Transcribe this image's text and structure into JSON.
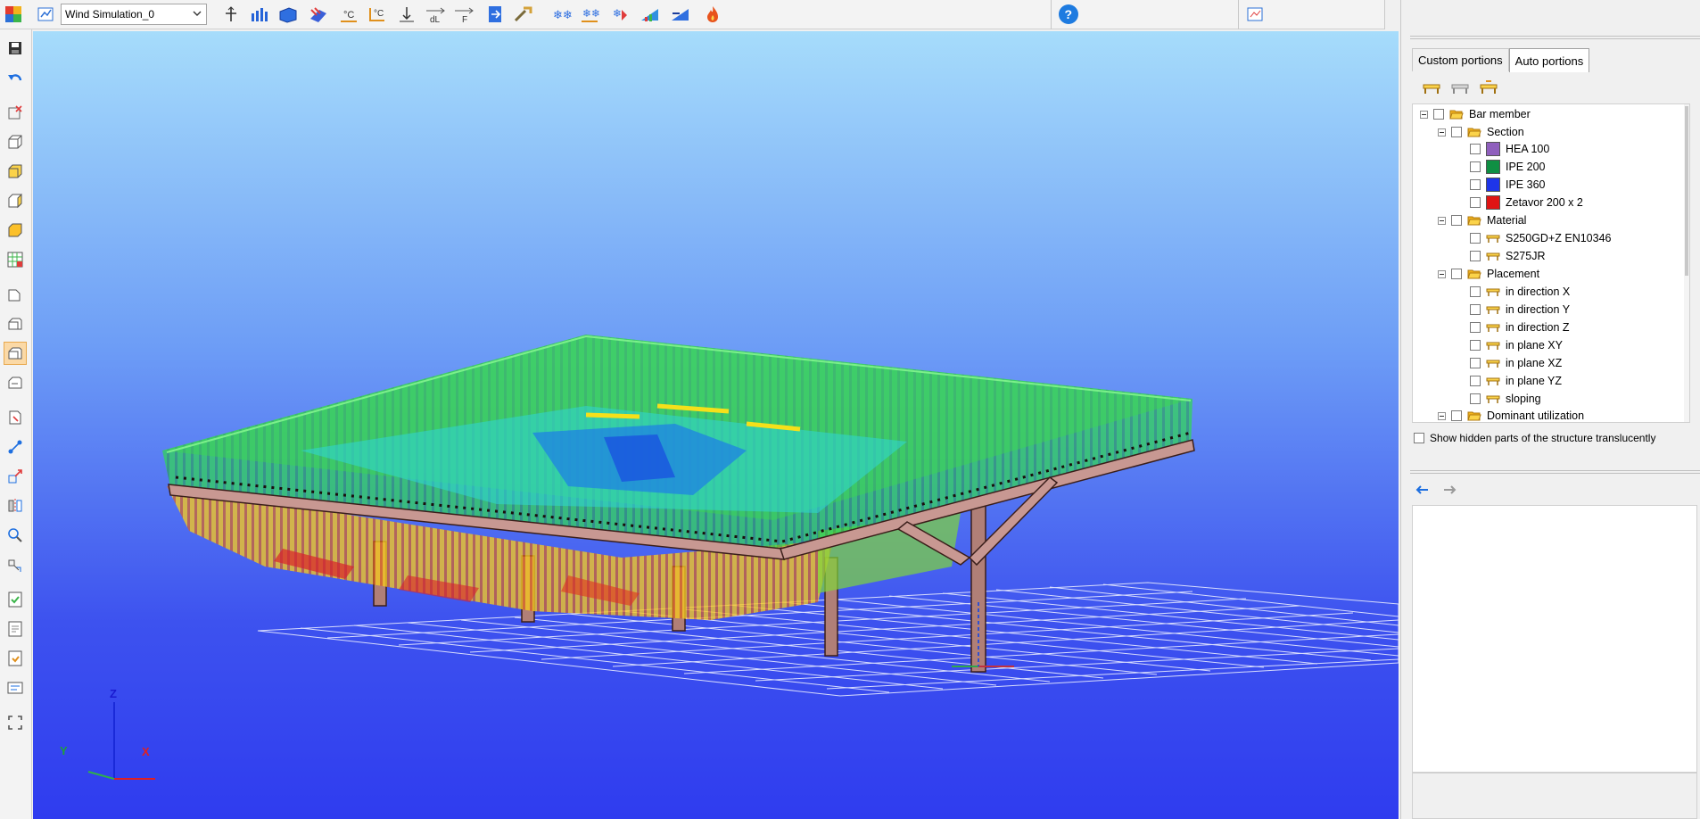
{
  "toolbar": {
    "app_icon": "app-logo-icon",
    "simulation_select": {
      "value": "Wind Simulation_0"
    },
    "tools": [
      "probe-icon",
      "velocity-bars-icon",
      "pressure-surface-icon",
      "streamlines-icon",
      "temperature-c-icon",
      "temperature-gradient-icon",
      "height-icon",
      "delta-length-icon",
      "force-icon",
      "export-icon",
      "wind-tunnel-icon",
      "snow-flakes-icon",
      "snow-drift-icon",
      "snow-load-icon",
      "wind-profile-icon",
      "wind-surface-icon",
      "fire-icon"
    ],
    "help_icon": "help-icon",
    "layout_icon": "layout-icon"
  },
  "left_tools": [
    "save-icon",
    "undo-icon",
    "select-nodes-icon",
    "view-front-icon",
    "view-top-icon",
    "view-side-icon",
    "view-iso-icon",
    "grid-view-icon",
    "model-2d-icon",
    "model-3d-icon",
    "render-mode-icon",
    "render-wire-icon",
    "member-select-icon",
    "node-select-icon",
    "move-icon",
    "mirror-icon",
    "search-icon",
    "transform-icon",
    "check-icon",
    "doc-icon",
    "load-icon",
    "list-icon",
    "fit-view-icon"
  ],
  "axes": {
    "z": "Z",
    "y": "Y",
    "x": "X"
  },
  "panel": {
    "tabs": [
      "Custom portions",
      "Auto portions"
    ],
    "active_tab": 1,
    "tree": {
      "root": "Bar member",
      "section": "Section",
      "section_items": [
        {
          "label": "HEA 100",
          "color": "#8f5fbd"
        },
        {
          "label": "IPE 200",
          "color": "#0f8f43"
        },
        {
          "label": "IPE 360",
          "color": "#1e35e8"
        },
        {
          "label": "Zetavor 200 x 2",
          "color": "#e01414"
        }
      ],
      "material": "Material",
      "material_items": [
        "S250GD+Z EN10346",
        "S275JR"
      ],
      "placement": "Placement",
      "placement_items": [
        "in direction X",
        "in direction Y",
        "in direction Z",
        "in plane XY",
        "in plane XZ",
        "in plane YZ",
        "sloping"
      ],
      "dominant": "Dominant utilization"
    },
    "translucent_label": "Show hidden parts of the structure translucently"
  }
}
